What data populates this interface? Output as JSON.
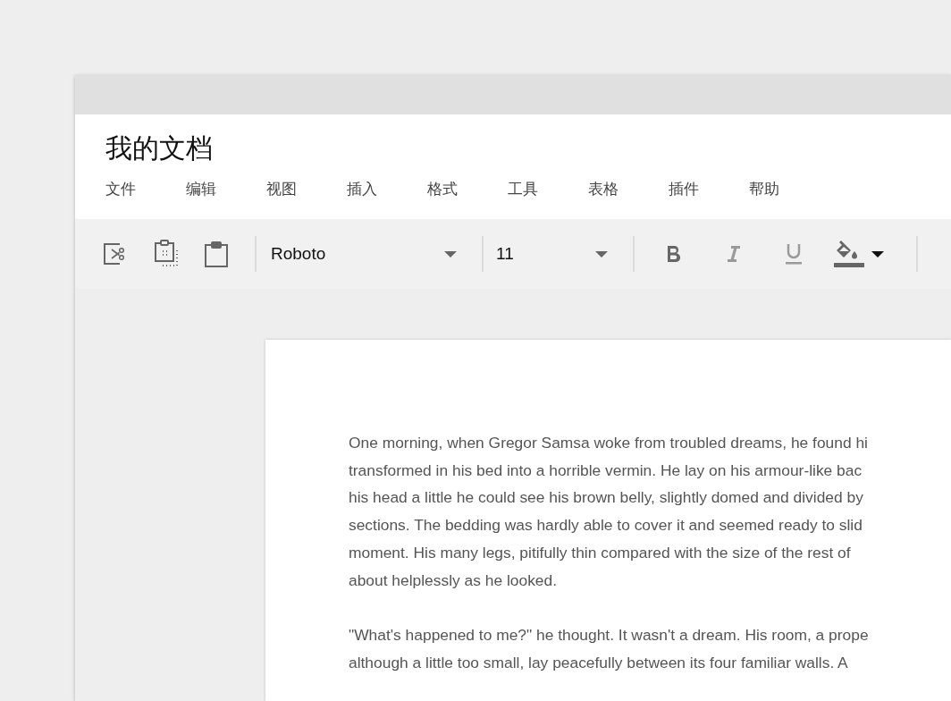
{
  "document_title": "我的文档",
  "menu": [
    "文件",
    "编辑",
    "视图",
    "插入",
    "格式",
    "工具",
    "表格",
    "插件",
    "帮助"
  ],
  "toolbar": {
    "clipboard": [
      {
        "kind": "cut"
      },
      {
        "kind": "copy"
      },
      {
        "kind": "paste"
      }
    ],
    "font": {
      "value": "Roboto"
    },
    "size": {
      "value": "11"
    },
    "format": [
      {
        "kind": "bold",
        "active": true
      },
      {
        "kind": "italic",
        "active": false
      },
      {
        "kind": "underline",
        "active": false
      }
    ],
    "fill": {
      "color": "#666666"
    }
  },
  "paragraphs": [
    {
      "lines": [
        "One morning, when Gregor Samsa woke from troubled dreams, he found hi",
        "transformed in his bed into a horrible vermin. He lay on his armour-like bac",
        "his head a little he could see his brown belly, slightly domed and divided by",
        "sections. The bedding was hardly able to cover it and seemed ready to slid",
        "moment. His many legs, pitifully thin compared with the size of the rest of",
        "about helplessly as he looked."
      ]
    },
    {
      "lines": [
        "\"What's happened to me?\" he thought. It wasn't a dream. His room, a prope",
        "although a little too small, lay peacefully between its four familiar walls. A"
      ]
    }
  ]
}
